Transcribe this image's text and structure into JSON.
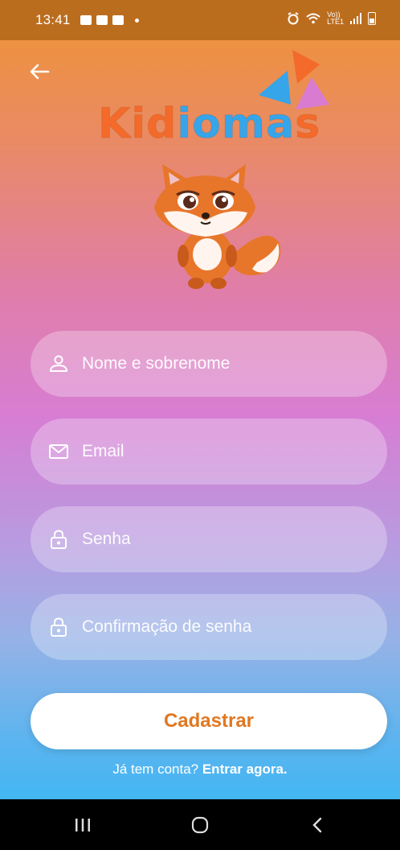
{
  "status_bar": {
    "time": "13:41",
    "net_label_top": "Vo))",
    "net_label_bottom": "LTE1"
  },
  "brand": {
    "logo_part1": "Ki",
    "logo_part2": "d",
    "logo_part3": "ioma",
    "logo_part4": "s",
    "mascot": "fox-mascot"
  },
  "form": {
    "name_placeholder": "Nome e sobrenome",
    "email_placeholder": "Email",
    "password_placeholder": "Senha",
    "confirm_placeholder": "Confirmação de senha"
  },
  "actions": {
    "submit_label": "Cadastrar",
    "login_prompt": "Já tem conta?",
    "login_link": "Entrar agora."
  },
  "icons": {
    "back": "arrow-left-icon",
    "name": "user-icon",
    "email": "envelope-icon",
    "password": "lock-icon",
    "confirm": "lock-icon"
  },
  "colors": {
    "accent_orange": "#e07822",
    "logo_blue": "#36a5ea",
    "logo_pink": "#d97bd0"
  }
}
